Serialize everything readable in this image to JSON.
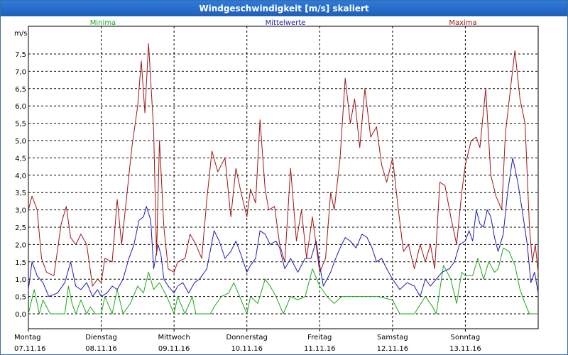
{
  "window": {
    "title": "Windgeschwindigkeit [m/s] skaliert"
  },
  "chart_data": {
    "type": "line",
    "title": "Windgeschwindigkeit [m/s] skaliert",
    "ylabel": "m/s",
    "ylim": [
      0,
      8
    ],
    "yticks": [
      "0,0",
      "0,5",
      "1,0",
      "1,5",
      "2,0",
      "2,5",
      "3,0",
      "3,5",
      "4,0",
      "4,5",
      "5,0",
      "5,5",
      "6,0",
      "6,5",
      "7,0",
      "7,5"
    ],
    "xlim": [
      0,
      7
    ],
    "grid": true,
    "legend_position": "top",
    "days": [
      {
        "weekday": "Montag",
        "date": "07.11.16"
      },
      {
        "weekday": "Dienstag",
        "date": "08.11.16"
      },
      {
        "weekday": "Mittwoch",
        "date": "09.11.16"
      },
      {
        "weekday": "Donnerstag",
        "date": "10.11.16"
      },
      {
        "weekday": "Freitag",
        "date": "11.11.16"
      },
      {
        "weekday": "Samstag",
        "date": "12.11.16"
      },
      {
        "weekday": "Sonntag",
        "date": "13.11.16"
      }
    ],
    "series": [
      {
        "name": "Minima",
        "color": "#1aaa1a",
        "points": [
          [
            0.0,
            0.0
          ],
          [
            0.08,
            0.7
          ],
          [
            0.15,
            0.0
          ],
          [
            0.2,
            0.4
          ],
          [
            0.3,
            0.0
          ],
          [
            0.5,
            0.0
          ],
          [
            0.55,
            0.8
          ],
          [
            0.6,
            0.3
          ],
          [
            0.65,
            0.0
          ],
          [
            0.72,
            0.4
          ],
          [
            0.8,
            0.0
          ],
          [
            0.85,
            0.2
          ],
          [
            0.92,
            0.0
          ],
          [
            1.0,
            0.0
          ],
          [
            1.05,
            0.5
          ],
          [
            1.15,
            0.0
          ],
          [
            1.22,
            0.7
          ],
          [
            1.3,
            0.0
          ],
          [
            1.4,
            0.3
          ],
          [
            1.5,
            0.8
          ],
          [
            1.58,
            0.6
          ],
          [
            1.65,
            1.2
          ],
          [
            1.72,
            0.7
          ],
          [
            1.8,
            0.9
          ],
          [
            1.9,
            0.5
          ],
          [
            2.0,
            0.0
          ],
          [
            2.05,
            0.5
          ],
          [
            2.15,
            0.0
          ],
          [
            2.25,
            0.5
          ],
          [
            2.3,
            0.0
          ],
          [
            2.5,
            0.0
          ],
          [
            2.55,
            0.2
          ],
          [
            2.65,
            0.5
          ],
          [
            2.75,
            0.6
          ],
          [
            2.82,
            0.9
          ],
          [
            2.9,
            0.5
          ],
          [
            3.0,
            0.0
          ],
          [
            3.05,
            0.5
          ],
          [
            3.15,
            0.3
          ],
          [
            3.25,
            1.0
          ],
          [
            3.32,
            0.8
          ],
          [
            3.4,
            0.5
          ],
          [
            3.5,
            0.0
          ],
          [
            3.6,
            0.5
          ],
          [
            3.7,
            0.4
          ],
          [
            3.8,
            0.5
          ],
          [
            3.9,
            1.3
          ],
          [
            4.0,
            0.8
          ],
          [
            4.1,
            0.5
          ],
          [
            4.2,
            0.3
          ],
          [
            4.3,
            0.5
          ],
          [
            4.5,
            0.5
          ],
          [
            4.8,
            0.5
          ],
          [
            5.0,
            0.4
          ],
          [
            5.1,
            0.0
          ],
          [
            5.3,
            0.0
          ],
          [
            5.45,
            0.5
          ],
          [
            5.55,
            0.2
          ],
          [
            5.6,
            0.0
          ],
          [
            5.7,
            1.4
          ],
          [
            5.8,
            1.0
          ],
          [
            5.88,
            0.3
          ],
          [
            5.95,
            1.2
          ],
          [
            6.0,
            1.1
          ],
          [
            6.1,
            1.1
          ],
          [
            6.17,
            1.6
          ],
          [
            6.25,
            1.0
          ],
          [
            6.32,
            1.5
          ],
          [
            6.4,
            1.2
          ],
          [
            6.45,
            1.3
          ],
          [
            6.52,
            1.9
          ],
          [
            6.6,
            1.8
          ],
          [
            6.68,
            1.4
          ],
          [
            6.75,
            0.7
          ],
          [
            6.82,
            0.3
          ],
          [
            6.88,
            0.0
          ],
          [
            7.0,
            0.0
          ]
        ]
      },
      {
        "name": "Mittelwerte",
        "color": "#1c1cb4",
        "points": [
          [
            0.0,
            0.7
          ],
          [
            0.05,
            1.5
          ],
          [
            0.12,
            1.1
          ],
          [
            0.2,
            0.9
          ],
          [
            0.28,
            0.5
          ],
          [
            0.4,
            0.6
          ],
          [
            0.5,
            0.9
          ],
          [
            0.58,
            1.5
          ],
          [
            0.65,
            0.8
          ],
          [
            0.72,
            0.7
          ],
          [
            0.8,
            0.9
          ],
          [
            0.88,
            0.5
          ],
          [
            0.95,
            0.7
          ],
          [
            1.0,
            0.5
          ],
          [
            1.08,
            0.6
          ],
          [
            1.15,
            0.8
          ],
          [
            1.22,
            0.7
          ],
          [
            1.3,
            1.0
          ],
          [
            1.38,
            1.6
          ],
          [
            1.45,
            2.0
          ],
          [
            1.52,
            2.7
          ],
          [
            1.58,
            2.8
          ],
          [
            1.62,
            3.1
          ],
          [
            1.68,
            2.7
          ],
          [
            1.72,
            1.3
          ],
          [
            1.78,
            2.0
          ],
          [
            1.82,
            1.7
          ],
          [
            1.86,
            1.0
          ],
          [
            1.92,
            0.8
          ],
          [
            2.0,
            0.6
          ],
          [
            2.05,
            0.8
          ],
          [
            2.12,
            0.9
          ],
          [
            2.2,
            0.6
          ],
          [
            2.28,
            0.9
          ],
          [
            2.35,
            1.0
          ],
          [
            2.45,
            1.3
          ],
          [
            2.55,
            2.4
          ],
          [
            2.62,
            2.1
          ],
          [
            2.7,
            1.6
          ],
          [
            2.78,
            1.8
          ],
          [
            2.85,
            2.1
          ],
          [
            2.92,
            1.7
          ],
          [
            3.0,
            1.2
          ],
          [
            3.05,
            1.4
          ],
          [
            3.12,
            1.6
          ],
          [
            3.18,
            2.4
          ],
          [
            3.25,
            2.3
          ],
          [
            3.32,
            2.0
          ],
          [
            3.4,
            2.1
          ],
          [
            3.45,
            1.9
          ],
          [
            3.52,
            1.3
          ],
          [
            3.6,
            1.6
          ],
          [
            3.7,
            1.2
          ],
          [
            3.8,
            1.6
          ],
          [
            3.88,
            1.6
          ],
          [
            3.95,
            2.1
          ],
          [
            4.0,
            1.4
          ],
          [
            4.05,
            0.8
          ],
          [
            4.15,
            1.2
          ],
          [
            4.2,
            1.5
          ],
          [
            4.28,
            1.9
          ],
          [
            4.35,
            2.2
          ],
          [
            4.42,
            2.1
          ],
          [
            4.5,
            1.9
          ],
          [
            4.58,
            2.3
          ],
          [
            4.65,
            2.2
          ],
          [
            4.72,
            1.9
          ],
          [
            4.78,
            1.5
          ],
          [
            4.85,
            1.6
          ],
          [
            4.92,
            1.3
          ],
          [
            5.0,
            1.0
          ],
          [
            5.1,
            0.7
          ],
          [
            5.2,
            0.9
          ],
          [
            5.3,
            0.8
          ],
          [
            5.38,
            0.5
          ],
          [
            5.45,
            1.0
          ],
          [
            5.52,
            0.8
          ],
          [
            5.6,
            1.0
          ],
          [
            5.68,
            1.2
          ],
          [
            5.78,
            1.3
          ],
          [
            5.85,
            1.5
          ],
          [
            5.92,
            2.0
          ],
          [
            6.0,
            2.1
          ],
          [
            6.05,
            2.4
          ],
          [
            6.1,
            2.1
          ],
          [
            6.15,
            3.0
          ],
          [
            6.2,
            2.6
          ],
          [
            6.25,
            2.5
          ],
          [
            6.3,
            3.0
          ],
          [
            6.35,
            2.8
          ],
          [
            6.4,
            2.2
          ],
          [
            6.45,
            1.8
          ],
          [
            6.52,
            2.3
          ],
          [
            6.58,
            3.5
          ],
          [
            6.65,
            4.5
          ],
          [
            6.72,
            3.8
          ],
          [
            6.78,
            3.0
          ],
          [
            6.85,
            2.0
          ],
          [
            6.9,
            0.9
          ],
          [
            6.95,
            1.2
          ],
          [
            7.0,
            0.6
          ]
        ]
      },
      {
        "name": "Maxima",
        "color": "#a01414",
        "points": [
          [
            0.0,
            3.0
          ],
          [
            0.05,
            3.4
          ],
          [
            0.12,
            3.0
          ],
          [
            0.18,
            1.6
          ],
          [
            0.25,
            1.2
          ],
          [
            0.35,
            1.1
          ],
          [
            0.45,
            2.6
          ],
          [
            0.52,
            3.1
          ],
          [
            0.58,
            2.2
          ],
          [
            0.65,
            2.0
          ],
          [
            0.72,
            2.3
          ],
          [
            0.8,
            2.0
          ],
          [
            0.88,
            0.8
          ],
          [
            0.95,
            1.0
          ],
          [
            1.0,
            0.9
          ],
          [
            1.05,
            1.6
          ],
          [
            1.15,
            1.5
          ],
          [
            1.22,
            3.3
          ],
          [
            1.28,
            2.0
          ],
          [
            1.35,
            3.4
          ],
          [
            1.42,
            4.8
          ],
          [
            1.5,
            6.0
          ],
          [
            1.55,
            7.3
          ],
          [
            1.6,
            5.8
          ],
          [
            1.65,
            7.8
          ],
          [
            1.72,
            5.3
          ],
          [
            1.76,
            1.7
          ],
          [
            1.8,
            5.0
          ],
          [
            1.86,
            2.5
          ],
          [
            1.92,
            1.3
          ],
          [
            2.0,
            1.2
          ],
          [
            2.05,
            1.5
          ],
          [
            2.15,
            1.6
          ],
          [
            2.22,
            2.3
          ],
          [
            2.3,
            2.0
          ],
          [
            2.38,
            1.6
          ],
          [
            2.45,
            3.3
          ],
          [
            2.52,
            4.7
          ],
          [
            2.6,
            4.1
          ],
          [
            2.7,
            4.5
          ],
          [
            2.78,
            2.8
          ],
          [
            2.85,
            4.2
          ],
          [
            2.92,
            3.5
          ],
          [
            3.0,
            2.8
          ],
          [
            3.05,
            3.6
          ],
          [
            3.12,
            3.2
          ],
          [
            3.18,
            5.6
          ],
          [
            3.25,
            3.6
          ],
          [
            3.3,
            3.0
          ],
          [
            3.38,
            3.1
          ],
          [
            3.45,
            2.0
          ],
          [
            3.52,
            1.5
          ],
          [
            3.6,
            4.2
          ],
          [
            3.68,
            2.1
          ],
          [
            3.75,
            3.0
          ],
          [
            3.82,
            1.6
          ],
          [
            3.9,
            2.8
          ],
          [
            3.95,
            2.0
          ],
          [
            4.0,
            1.2
          ],
          [
            4.08,
            1.6
          ],
          [
            4.15,
            3.5
          ],
          [
            4.2,
            3.0
          ],
          [
            4.28,
            4.5
          ],
          [
            4.35,
            6.8
          ],
          [
            4.42,
            5.5
          ],
          [
            4.48,
            6.2
          ],
          [
            4.55,
            4.8
          ],
          [
            4.62,
            6.5
          ],
          [
            4.7,
            5.1
          ],
          [
            4.78,
            5.4
          ],
          [
            4.85,
            4.3
          ],
          [
            4.92,
            3.8
          ],
          [
            5.0,
            4.5
          ],
          [
            5.08,
            3.0
          ],
          [
            5.15,
            1.8
          ],
          [
            5.22,
            2.0
          ],
          [
            5.3,
            1.3
          ],
          [
            5.38,
            2.0
          ],
          [
            5.45,
            1.5
          ],
          [
            5.52,
            2.0
          ],
          [
            5.58,
            1.3
          ],
          [
            5.65,
            3.8
          ],
          [
            5.72,
            3.7
          ],
          [
            5.8,
            2.8
          ],
          [
            5.88,
            2.0
          ],
          [
            5.95,
            3.5
          ],
          [
            6.0,
            4.3
          ],
          [
            6.08,
            5.0
          ],
          [
            6.15,
            5.1
          ],
          [
            6.2,
            4.8
          ],
          [
            6.28,
            6.5
          ],
          [
            6.35,
            4.0
          ],
          [
            6.42,
            3.4
          ],
          [
            6.5,
            3.0
          ],
          [
            6.55,
            5.2
          ],
          [
            6.62,
            6.5
          ],
          [
            6.68,
            7.6
          ],
          [
            6.75,
            6.2
          ],
          [
            6.82,
            5.5
          ],
          [
            6.88,
            2.5
          ],
          [
            6.92,
            1.5
          ],
          [
            6.96,
            2.0
          ],
          [
            7.0,
            1.2
          ]
        ]
      }
    ]
  }
}
